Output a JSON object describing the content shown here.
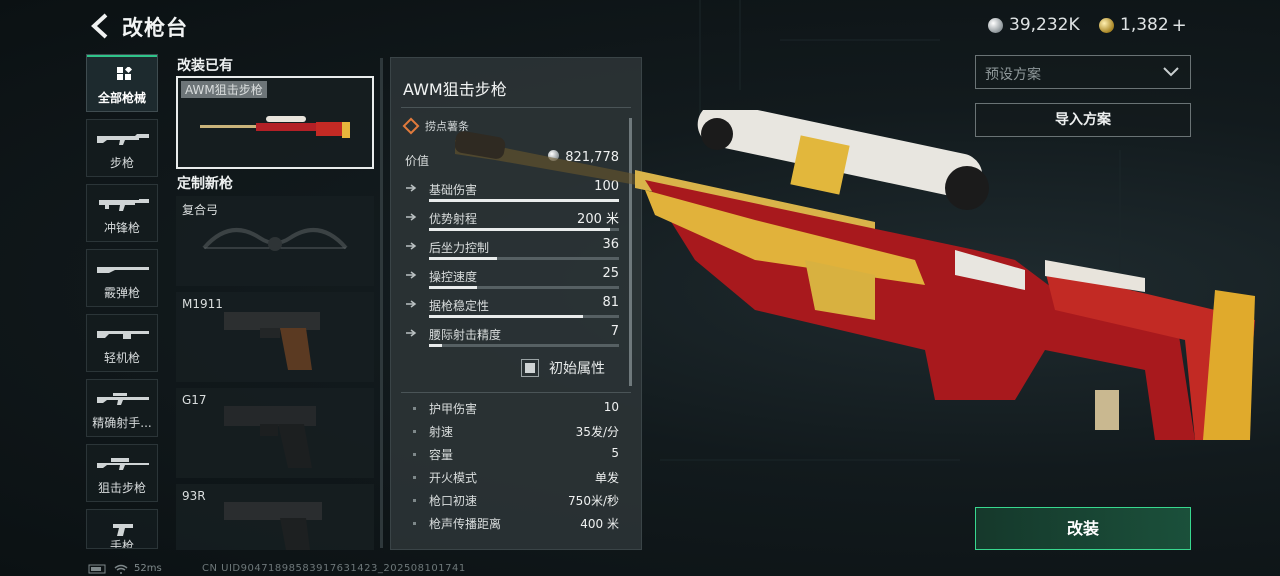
{
  "header": {
    "title": "改枪台"
  },
  "currency": {
    "silver": "39,232K",
    "gold": "1,382",
    "add": "+"
  },
  "categories": [
    {
      "label": "全部枪械"
    },
    {
      "label": "步枪"
    },
    {
      "label": "冲锋枪"
    },
    {
      "label": "霰弹枪"
    },
    {
      "label": "轻机枪"
    },
    {
      "label": "精确射手..."
    },
    {
      "label": "狙击步枪"
    },
    {
      "label": "手枪"
    }
  ],
  "list": {
    "owned_section": "改装已有",
    "new_section": "定制新枪",
    "owned": [
      {
        "name": "AWM狙击步枪"
      }
    ],
    "new": [
      {
        "name": "复合弓"
      },
      {
        "name": "M1911"
      },
      {
        "name": "G17"
      },
      {
        "name": "93R"
      }
    ]
  },
  "panel": {
    "title": "AWM狙击步枪",
    "source": "捞点薯条",
    "value_label": "价值",
    "value": "821,778",
    "stats": [
      {
        "label": "基础伤害",
        "value": "100",
        "fill": 1.0
      },
      {
        "label": "优势射程",
        "value": "200 米",
        "fill": 0.95
      },
      {
        "label": "后坐力控制",
        "value": "36",
        "fill": 0.36
      },
      {
        "label": "操控速度",
        "value": "25",
        "fill": 0.25
      },
      {
        "label": "据枪稳定性",
        "value": "81",
        "fill": 0.81
      },
      {
        "label": "腰际射击精度",
        "value": "7",
        "fill": 0.07
      }
    ],
    "initial_attr": "初始属性",
    "attributes": [
      {
        "label": "护甲伤害",
        "value": "10"
      },
      {
        "label": "射速",
        "value": "35发/分"
      },
      {
        "label": "容量",
        "value": "5"
      },
      {
        "label": "开火模式",
        "value": "单发"
      },
      {
        "label": "枪口初速",
        "value": "750米/秒"
      },
      {
        "label": "枪声传播距离",
        "value": "400 米"
      }
    ]
  },
  "right": {
    "preset": "预设方案",
    "import": "导入方案",
    "modify": "改装"
  },
  "footer": {
    "ping": "52ms",
    "uid": "CN UID904718985839176314​23_202508101741"
  },
  "colors": {
    "accent_green": "#2fc48a",
    "source_orange": "#e07a3c",
    "gun_red": "#a01d22",
    "gun_gold": "#e2b73c"
  }
}
